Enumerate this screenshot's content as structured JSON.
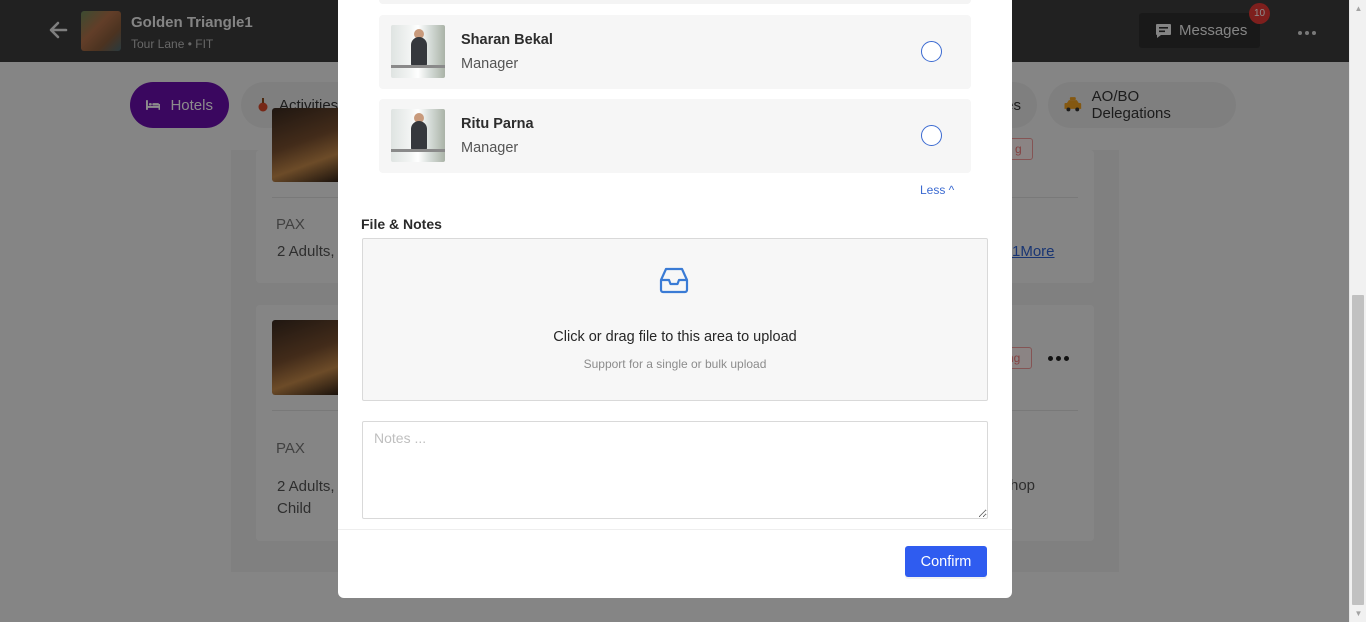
{
  "header": {
    "trip_title": "Golden Triangle1",
    "trip_subtitle": "Tour Lane • FIT",
    "messages_label": "Messages",
    "messages_badge": "10"
  },
  "tabs": [
    {
      "label": "Hotels",
      "active": true
    },
    {
      "label": "Activities"
    },
    {
      "label": "es"
    },
    {
      "label": "AO/BO Delegations"
    }
  ],
  "background": {
    "card1": {
      "pax_label": "PAX",
      "pax_value": "2 Adults,",
      "more_link": "1More",
      "tag": "g"
    },
    "card2": {
      "pax_label": "PAX",
      "pax_value_line1": "2 Adults,",
      "pax_value_line2": "Child",
      "extra_text": "hop",
      "tag": "ng"
    }
  },
  "modal": {
    "members": [
      {
        "name": "Sharan Bekal",
        "role": "Manager"
      },
      {
        "name": "Ritu Parna",
        "role": "Manager"
      }
    ],
    "less_label": "Less ^",
    "section_title": "File & Notes",
    "upload_text": "Click or drag file to this area to upload",
    "upload_hint": "Support for a single or bulk upload",
    "notes_placeholder": "Notes ...",
    "confirm_label": "Confirm"
  },
  "colors": {
    "accent_purple": "#6a0dad",
    "primary_blue": "#2f5cf0",
    "badge_red": "#e53935"
  }
}
